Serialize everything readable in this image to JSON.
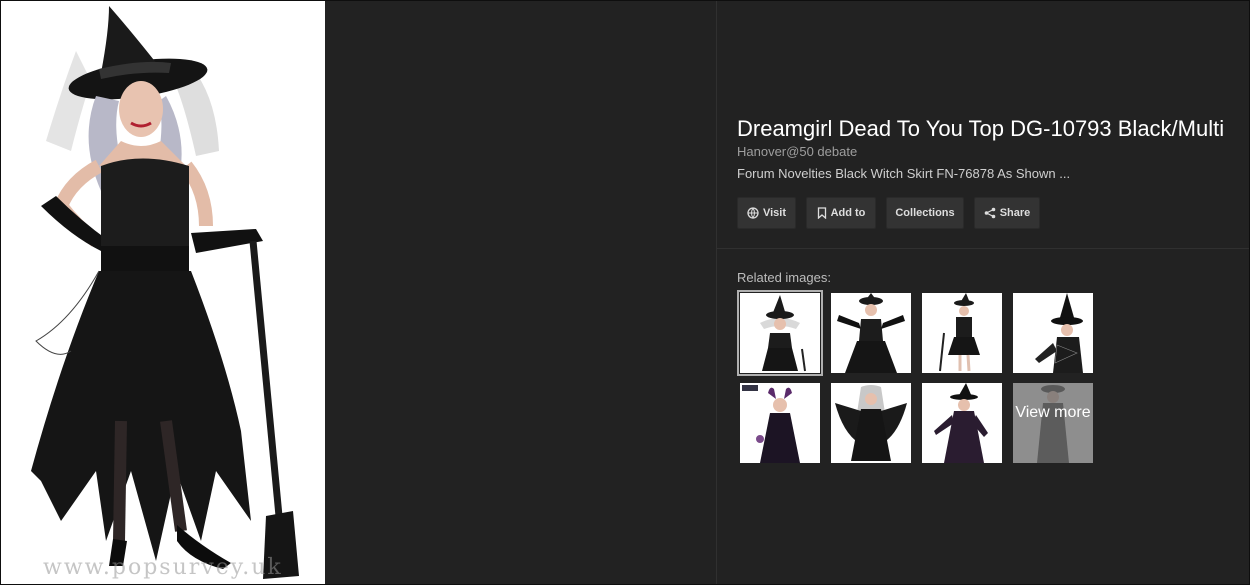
{
  "main_image": {
    "watermark": "www.popsurvey.uk"
  },
  "detail": {
    "title": "Dreamgirl Dead To You Top DG-10793 Black/Multi",
    "source": "Hanover@50 debate",
    "description": "Forum Novelties Black Witch Skirt FN-76878 As Shown ..."
  },
  "actions": {
    "visit": "Visit",
    "add_to": "Add to",
    "collections": "Collections",
    "share": "Share"
  },
  "related": {
    "label": "Related images:",
    "view_more": "View more"
  },
  "colors": {
    "background": "#222222",
    "button": "#333333",
    "title": "#ffffff"
  }
}
